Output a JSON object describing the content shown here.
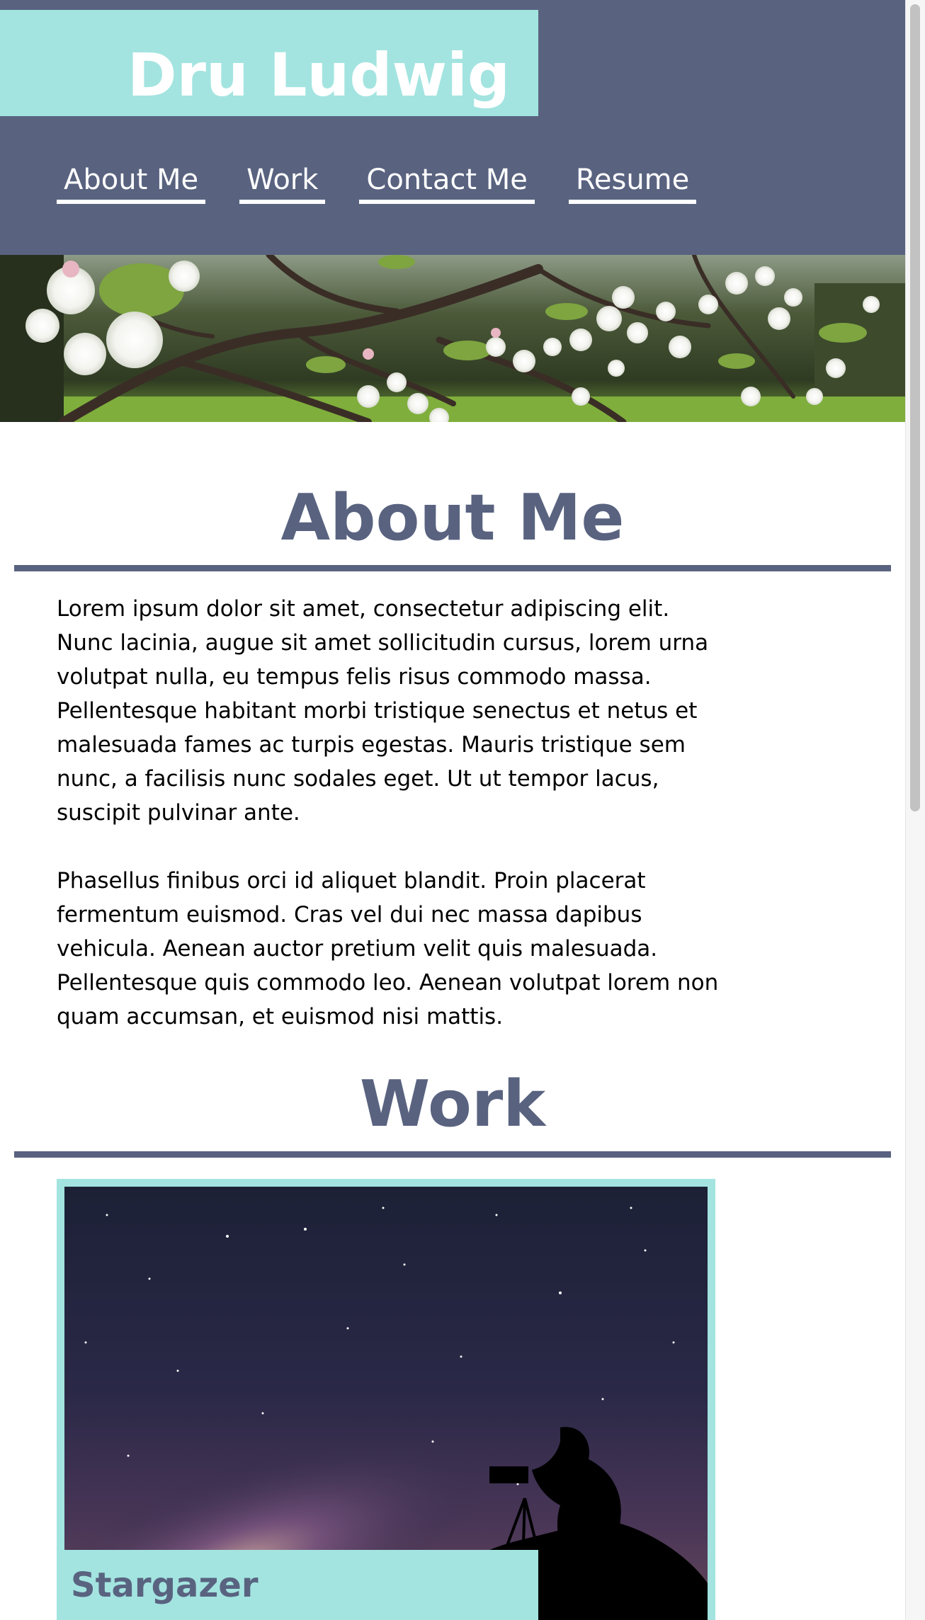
{
  "header": {
    "logo": "Dru Ludwig",
    "nav": [
      {
        "label": "About Me"
      },
      {
        "label": "Work"
      },
      {
        "label": "Contact Me"
      },
      {
        "label": "Resume"
      }
    ]
  },
  "about": {
    "title": "About Me",
    "paragraphs": [
      "Lorem ipsum dolor sit amet, consectetur adipiscing elit. Nunc lacinia, augue sit amet sollicitudin cursus, lorem urna volutpat nulla, eu tempus felis risus commodo massa. Pellentesque habitant morbi tristique senectus et netus et malesuada fames ac turpis egestas. Mauris tristique sem nunc, a facilisis nunc sodales eget. Ut ut tempor lacus, suscipit pulvinar ante.",
      "Phasellus finibus orci id aliquet blandit. Proin placerat fermentum euismod. Cras vel dui nec massa dapibus vehicula. Aenean auctor pretium velit quis malesuada. Pellentesque quis commodo leo. Aenean volutpat lorem non quam accumsan, et euismod nisi mattis."
    ]
  },
  "work": {
    "title": "Work",
    "projects": [
      {
        "title": "Stargazer"
      }
    ]
  },
  "colors": {
    "header_bg": "#596380",
    "accent": "#a3e4e0",
    "heading": "#596380"
  }
}
